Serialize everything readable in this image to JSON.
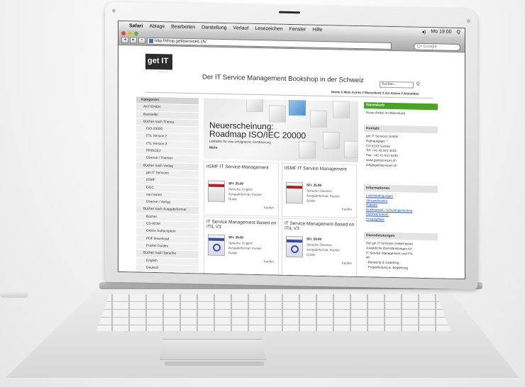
{
  "menubar": {
    "apple": "",
    "app": "Safari",
    "items": [
      "Ablage",
      "Bearbeiten",
      "Darstellung",
      "Verlauf",
      "Lesezeichen",
      "Fenster",
      "Hilfe"
    ],
    "volume": "◂)",
    "clock": "Mo 19:00",
    "spotlight": "Q"
  },
  "browser": {
    "url": "http://shop.getitservices.ch/",
    "search_placeholder": "Q• Google",
    "back": "◂",
    "forward": "▸",
    "add": "+"
  },
  "site": {
    "logo": "get IT",
    "logo_sub": "SERVICES",
    "title": "Der IT Service Management Bookshop in der Schweiz",
    "search_placeholder": "Suchen...",
    "search_icon": "Q",
    "topnav": "Home // Mein Konto // Warenkorb // Zur Kasse // Anmelden"
  },
  "sidebar": {
    "items": [
      {
        "label": "Kategorien",
        "kind": "head"
      },
      {
        "label": "AKTIONEN",
        "kind": "item"
      },
      {
        "label": "Bestseller",
        "kind": "item"
      },
      {
        "label": "Bücher nach Thema",
        "kind": "item"
      },
      {
        "label": "ISO-20000",
        "kind": "sub"
      },
      {
        "label": "ITIL Version 2",
        "kind": "sub"
      },
      {
        "label": "ITIL Version 3",
        "kind": "sub"
      },
      {
        "label": "PRINCE2",
        "kind": "sub"
      },
      {
        "label": "Diverse / Themen",
        "kind": "sub"
      },
      {
        "label": "Bücher nach Verlag",
        "kind": "item"
      },
      {
        "label": "get IT Services",
        "kind": "sub"
      },
      {
        "label": "itSMF",
        "kind": "sub"
      },
      {
        "label": "OGC",
        "kind": "sub"
      },
      {
        "label": "van Haren",
        "kind": "sub"
      },
      {
        "label": "Diverse / Verlag",
        "kind": "sub"
      },
      {
        "label": "Bücher nach Ausgabeformat",
        "kind": "item"
      },
      {
        "label": "Bücher",
        "kind": "sub"
      },
      {
        "label": "CD-ROM",
        "kind": "sub"
      },
      {
        "label": "Online Subscription",
        "kind": "sub"
      },
      {
        "label": "PDF Download",
        "kind": "sub"
      },
      {
        "label": "Pocket Guides",
        "kind": "sub"
      },
      {
        "label": "Bücher nach Sprache",
        "kind": "item"
      },
      {
        "label": "English",
        "kind": "sub"
      },
      {
        "label": "Deutsch",
        "kind": "sub"
      }
    ]
  },
  "hero": {
    "title_line1": "Neuerscheinung:",
    "title_line2": "Roadmap ISO/IEC 20000",
    "subtitle": "Leitfaden für eine erfolgreiche Zertifizierung",
    "more": "Mehr"
  },
  "products": [
    {
      "title": "itSMF IT Service Management",
      "price": "SFr. 25.00",
      "lang": "Sprache: English",
      "format1": "Ausgabeformat: Pocket",
      "format2": "Guide",
      "buy": "Kaufen"
    },
    {
      "title": "itSMF IT Service Management",
      "price": "SFr. 25.00",
      "lang": "Sprache: Deutsch",
      "format1": "Ausgabeformat: Pocket",
      "format2": "Guide",
      "buy": "Kaufen"
    },
    {
      "title": "IT Service Management Based on ITIL V3",
      "price": "SFr. 29.00",
      "lang": "Sprache: English",
      "format1": "Ausgabeformat: Pocket",
      "format2": "Guide",
      "buy": "Kaufen"
    },
    {
      "title": "IT Service Management Based on ITIL V3",
      "price": "SFr. 29.00",
      "lang": "Sprache: Deutsch",
      "format1": "Ausgabeformat: Pocket",
      "format2": "Guide",
      "buy": "Kaufen"
    }
  ],
  "right": {
    "cart_title": "Warenkorb",
    "cart_text": "Keine Artikel im Warenkorb.",
    "contact_title": "Kontakt",
    "contact_lines": [
      "get IT Services GmbH",
      "Rathausplatz 7",
      "CH 6210 Sursee",
      "Tel: +41 41 921 9191",
      "Fax: +41 41 921 9193",
      "www.getitservices.ch",
      "info@getitservices.ch"
    ],
    "info_title": "Informationen",
    "info_links": [
      "Lieferbedingungen",
      "Versandkosten",
      "Rabatte",
      "Buchhandel / Schulungsinstitute",
      "Mehrwertsteuer",
      "Privatsphäre"
    ],
    "services_title": "Dienstleistungen",
    "services_lines": [
      "Die get IT Services GmbH bietet",
      "zusätzliche Dienstleistungen für",
      "IT Service Management und ITIL",
      "an:",
      "- Beratung & Coaching",
      "- Projektleitung & -begleitung"
    ]
  }
}
